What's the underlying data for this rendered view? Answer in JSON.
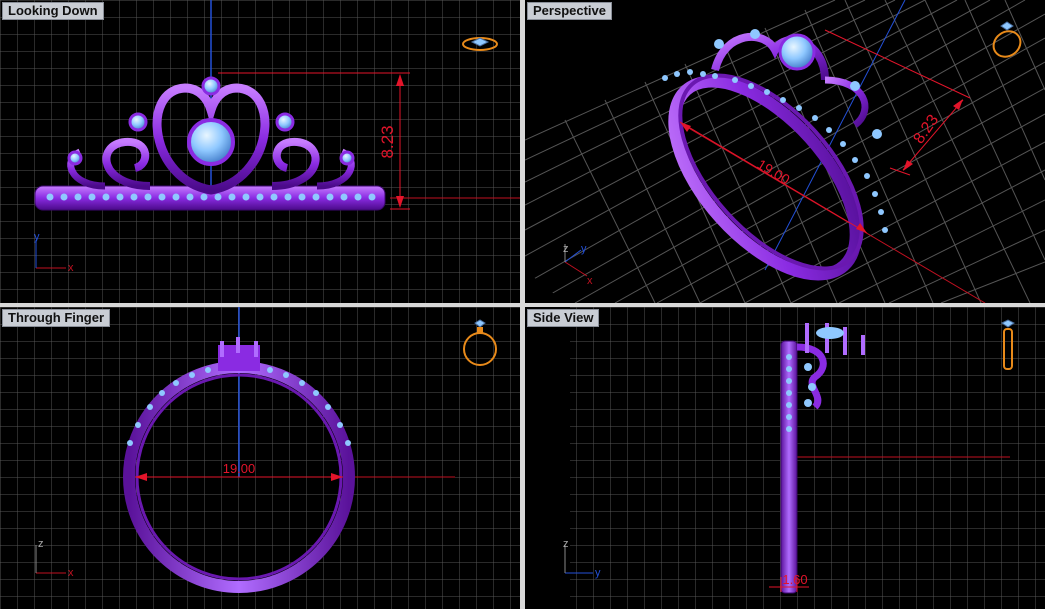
{
  "viewports": {
    "top": {
      "label": "Looking Down",
      "dimension": "8.23",
      "axes": {
        "a": "y",
        "b": "x"
      }
    },
    "perspective": {
      "label": "Perspective",
      "dimension_width": "8.23",
      "dimension_diameter": "19.00",
      "axes": {
        "a": "z",
        "b": "y",
        "c": "x"
      }
    },
    "front": {
      "label": "Through Finger",
      "dimension": "19.00",
      "axes": {
        "a": "z",
        "b": "x"
      }
    },
    "side": {
      "label": "Side View",
      "dimension": "1.60",
      "axes": {
        "a": "z",
        "b": "y"
      }
    }
  },
  "colors": {
    "background": "#000000",
    "grid": "#5a5a5a",
    "ring_metal": "#8a2be2",
    "gem": "#8fc8ff",
    "dimension": "#e3142a",
    "view_cube_icon": "#e88a1a"
  },
  "icons": [
    "ring-view-icon"
  ]
}
